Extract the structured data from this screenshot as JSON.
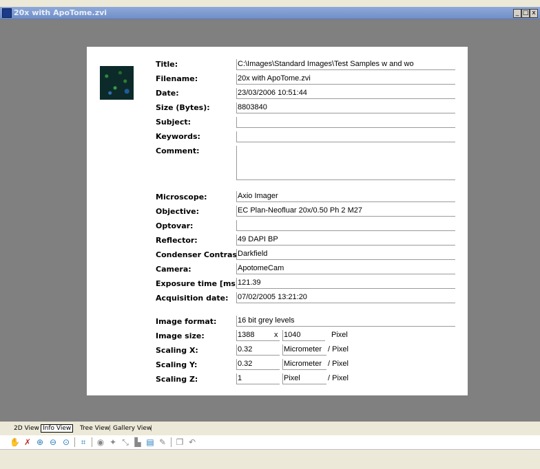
{
  "window": {
    "title": "20x with ApoTome.zvi",
    "buttons": [
      "_",
      "□",
      "x"
    ]
  },
  "fields": [
    {
      "label": "Title:",
      "value": "C:\\Images\\Standard Images\\Test Samples w and wo"
    },
    {
      "label": "Filename:",
      "value": "20x with ApoTome.zvi"
    },
    {
      "label": "Date:",
      "value": "23/03/2006 10:51:44"
    },
    {
      "label": "Size (Bytes):",
      "value": "8803840"
    },
    {
      "label": "Subject:",
      "value": ""
    },
    {
      "label": "Keywords:",
      "value": ""
    },
    {
      "label": "Comment:",
      "value": ""
    },
    {
      "label": "Microscope:",
      "value": "Axio Imager"
    },
    {
      "label": "Objective:",
      "value": "EC Plan-Neofluar 20x/0.50 Ph 2 M27"
    },
    {
      "label": "Optovar:",
      "value": ""
    },
    {
      "label": "Reflector:",
      "value": "49 DAPI BP"
    },
    {
      "label": "Condenser Contrast:",
      "value": "Darkfield"
    },
    {
      "label": "Camera:",
      "value": "ApotomeCam"
    },
    {
      "label": "Exposure time [ms]:",
      "value": "121.39"
    },
    {
      "label": "Acquisition date:",
      "value": "07/02/2005 13:21:20"
    },
    {
      "label": "Image format:",
      "value": "16 bit grey levels"
    }
  ],
  "image_size": {
    "label": "Image size:",
    "width": "1388",
    "x": "x",
    "height": "1040",
    "unit": "Pixel"
  },
  "scaling": [
    {
      "label": "Scaling X:",
      "value": "0.32",
      "unit": "Micrometer",
      "per": "/ Pixel"
    },
    {
      "label": "Scaling Y:",
      "value": "0.32",
      "unit": "Micrometer",
      "per": "/ Pixel"
    },
    {
      "label": "Scaling Z:",
      "value": "1",
      "unit": "Pixel",
      "per": "/ Pixel"
    }
  ],
  "tabs": [
    {
      "label": "2D View"
    },
    {
      "label": "Info View"
    },
    {
      "label": "Tree View"
    },
    {
      "label": "Gallery View"
    }
  ],
  "toolbar_icons": [
    "pan-icon",
    "delete-icon",
    "zoom-in-icon",
    "zoom-out-icon",
    "zoom-fit-icon",
    "crop-icon",
    "channel-icon",
    "marker-icon",
    "graph-icon",
    "histogram-icon",
    "export-icon",
    "draw-icon",
    "copy-icon",
    "undo-icon"
  ]
}
